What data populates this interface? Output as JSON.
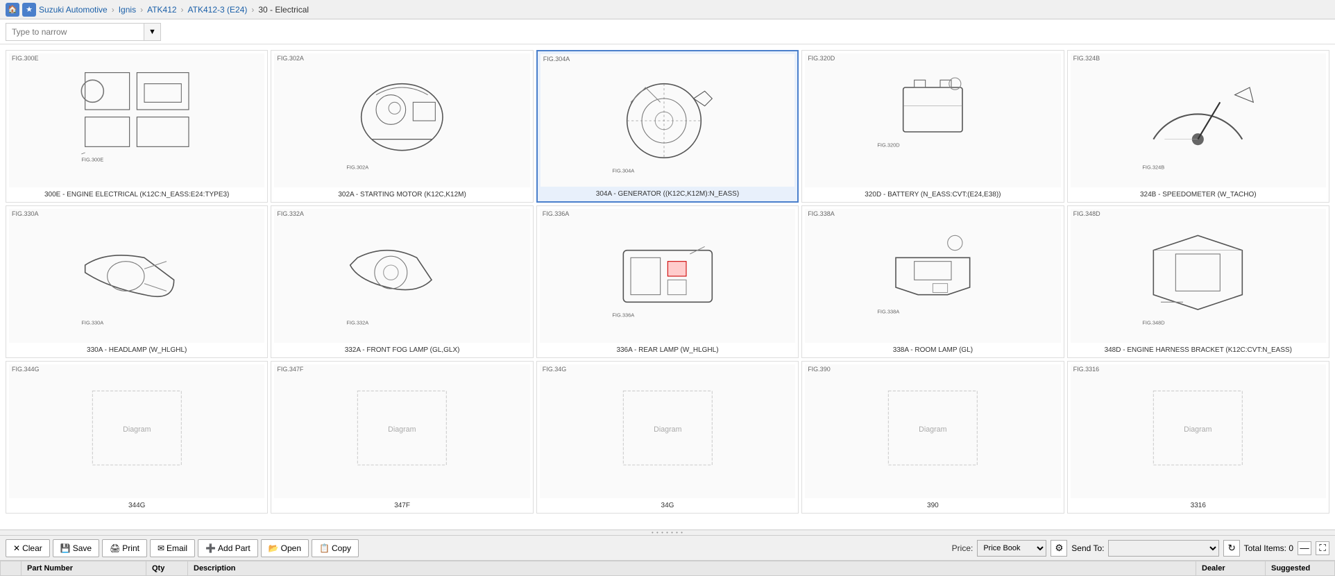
{
  "nav": {
    "home_icon": "🏠",
    "star_icon": "★",
    "breadcrumbs": [
      {
        "label": "Suzuki Automotive",
        "link": true
      },
      {
        "label": "Ignis",
        "link": true
      },
      {
        "label": "ATK412",
        "link": true
      },
      {
        "label": "ATK412-3 (E24)",
        "link": true
      },
      {
        "label": "30 - Electrical",
        "link": false
      }
    ]
  },
  "search": {
    "placeholder": "Type to narrow"
  },
  "diagrams": [
    {
      "id": "300E",
      "fig": "FIG.300E",
      "label": "300E - ENGINE ELECTRICAL (K12C:N_EASS:E24:TYPE3)",
      "selected": false
    },
    {
      "id": "302A",
      "fig": "FIG.302A",
      "label": "302A - STARTING MOTOR (K12C,K12M)",
      "selected": false
    },
    {
      "id": "304A",
      "fig": "FIG.304A",
      "label": "304A - GENERATOR ((K12C,K12M):N_EASS)",
      "selected": true
    },
    {
      "id": "320D",
      "fig": "FIG.320D",
      "label": "320D - BATTERY (N_EASS:CVT:(E24,E38))",
      "selected": false
    },
    {
      "id": "324B",
      "fig": "FIG.324B",
      "label": "324B - SPEEDOMETER (W_TACHO)",
      "selected": false
    },
    {
      "id": "330A",
      "fig": "FIG.330A",
      "label": "330A - HEADLAMP (W_HLGHL)",
      "selected": false
    },
    {
      "id": "332A",
      "fig": "FIG.332A",
      "label": "332A - FRONT FOG LAMP (GL,GLX)",
      "selected": false
    },
    {
      "id": "336A",
      "fig": "FIG.336A",
      "label": "336A - REAR LAMP (W_HLGHL)",
      "selected": false
    },
    {
      "id": "338A",
      "fig": "FIG.338A",
      "label": "338A - ROOM LAMP (GL)",
      "selected": false
    },
    {
      "id": "348D",
      "fig": "FIG.348D",
      "label": "348D - ENGINE HARNESS BRACKET (K12C:CVT:N_EASS)",
      "selected": false
    },
    {
      "id": "344G",
      "fig": "FIG.344G",
      "label": "344G",
      "selected": false
    },
    {
      "id": "347F",
      "fig": "FIG.347F",
      "label": "347F",
      "selected": false
    },
    {
      "id": "34G",
      "fig": "FIG.34G",
      "label": "34G",
      "selected": false
    },
    {
      "id": "390",
      "fig": "FIG.390",
      "label": "390",
      "selected": false
    },
    {
      "id": "3316",
      "fig": "FIG.3316",
      "label": "3316",
      "selected": false
    }
  ],
  "toolbar": {
    "clear_label": "Clear",
    "save_label": "Save",
    "print_label": "Print",
    "email_label": "Email",
    "add_part_label": "Add Part",
    "open_label": "Open",
    "copy_label": "Copy",
    "price_label": "Price:",
    "price_options": [
      "Price Book"
    ],
    "price_selected": "Price Book",
    "send_to_label": "Send To:",
    "send_options": [
      ""
    ],
    "total_label": "Total Items: 0"
  },
  "parts_table": {
    "columns": [
      "",
      "Part Number",
      "Qty",
      "Description",
      "Dealer",
      "Suggested"
    ],
    "rows": []
  }
}
